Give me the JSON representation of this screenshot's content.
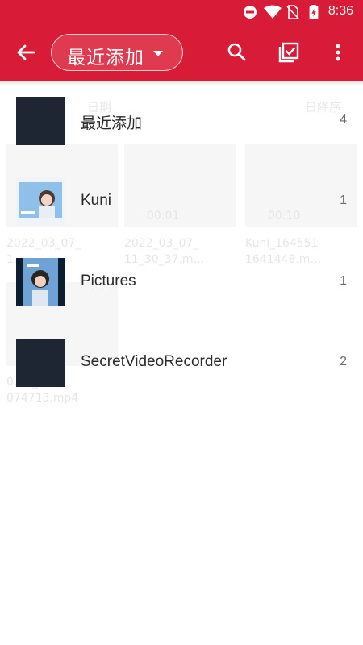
{
  "status": {
    "time": "8:36",
    "icons": [
      "do-not-disturb-icon",
      "wifi-icon",
      "no-sim-icon",
      "battery-charging-icon"
    ]
  },
  "toolbar": {
    "back_icon": "arrow-back-icon",
    "dropdown_label": "最近添加",
    "search_icon": "search-icon",
    "select_icon": "select-all-icon",
    "more_icon": "more-vert-icon"
  },
  "background": {
    "sort_label": "日期",
    "order_label": "日降序",
    "items": [
      {
        "duration": "",
        "caption": "2022_03_07_\n1…"
      },
      {
        "duration": "00:01",
        "caption": "2022_03_07_\n11_30_37.m…"
      },
      {
        "duration": "00:10",
        "caption": "Kuni_164551\n1641448.m…"
      },
      {
        "duration": "",
        "caption": "0…9_\n074713.mp4"
      }
    ]
  },
  "folders": [
    {
      "name": "最近添加",
      "count": "4",
      "thumb": "dark"
    },
    {
      "name": "Kuni",
      "count": "1",
      "thumb": "img1"
    },
    {
      "name": "Pictures",
      "count": "1",
      "thumb": "img2"
    },
    {
      "name": "SecretVideoRecorder",
      "count": "2",
      "thumb": "dark"
    }
  ],
  "colors": {
    "primary": "#d81b36",
    "thumb_dark": "#1f2633"
  }
}
